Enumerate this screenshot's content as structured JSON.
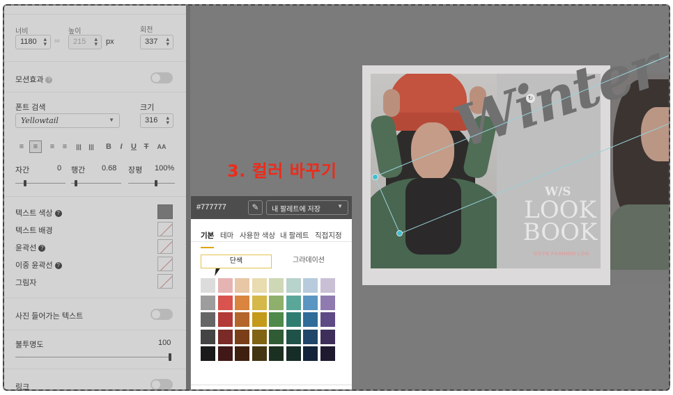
{
  "dimensions": {
    "width_label": "너비",
    "width_value": "1180",
    "height_label": "높이",
    "height_value": "215",
    "unit": "px",
    "rotation_label": "회전",
    "rotation_value": "337"
  },
  "motion": {
    "label": "모션효과",
    "enabled": false
  },
  "font": {
    "search_label": "폰트 검색",
    "size_label": "크기",
    "family_value": "Yellowtail",
    "size_value": "316"
  },
  "toolbar_icons": [
    "align-left-icon",
    "align-center-icon",
    "align-right-icon",
    "align-justify-icon",
    "vertical-text-icon",
    "vertical-text-alt-icon",
    "bold-icon",
    "italic-icon",
    "underline-icon",
    "strikethrough-icon",
    "case-icon"
  ],
  "spacing": {
    "letter_label": "자간",
    "letter_value": "0",
    "letter_level": 0.2,
    "line_label": "행간",
    "line_value": "0.68",
    "line_level": 0.1,
    "width_label": "장평",
    "width_value": "100%",
    "width_level": 0.6
  },
  "style_rows": {
    "text_color": "텍스트 색상",
    "text_bg": "텍스트 배경",
    "outline": "윤곽선",
    "double_outline": "이중 윤곽선",
    "shadow": "그림자"
  },
  "photo_text": {
    "label": "사진 들어가는 텍스트",
    "enabled": false
  },
  "opacity": {
    "label": "불투명도",
    "value": "100",
    "level": 1.0
  },
  "link": {
    "label": "링크",
    "enabled": false
  },
  "annotation": "3. 컬러 바꾸기",
  "picker": {
    "hex": "#777777",
    "save_label": "내 팔레트에 저장",
    "tabs": [
      "기본",
      "테마",
      "사용한 색상",
      "내 팔레트",
      "직접지정"
    ],
    "active_tab": "기본",
    "solid_label": "단색",
    "gradient_label": "그라데이션",
    "palette": [
      [
        "#dcdcdc",
        "#e6b3b3",
        "#e8c7a6",
        "#e8dcb0",
        "#cfd8b6",
        "#b8d2cc",
        "#b7cbdc",
        "#c9c0d6"
      ],
      [
        "#9d9d9d",
        "#d9534f",
        "#d9843f",
        "#d4b84a",
        "#8fb06c",
        "#5aa79a",
        "#5b95c2",
        "#8f7bb0"
      ],
      [
        "#666666",
        "#b33a36",
        "#b3652b",
        "#c49a1a",
        "#4f8a4a",
        "#2e7d70",
        "#2f6c98",
        "#5e4a84"
      ],
      [
        "#444444",
        "#7a2a27",
        "#7a3f18",
        "#806313",
        "#2f5b35",
        "#1f5248",
        "#20466a",
        "#3d2f5a"
      ],
      [
        "#1a1a1a",
        "#3f1817",
        "#3f2010",
        "#433512",
        "#1b3020",
        "#162c27",
        "#13243a",
        "#201a30"
      ]
    ]
  },
  "design": {
    "script_text": "Winter",
    "subtitle": "W/S",
    "headline": "LOOK BOOK",
    "brand": "COYE FASHION LOG"
  },
  "colors": {
    "accent_red": "#ee2a1a",
    "selected_color": "#777777",
    "handle": "#2fd0e6",
    "tab_underline": "#e2a400"
  }
}
